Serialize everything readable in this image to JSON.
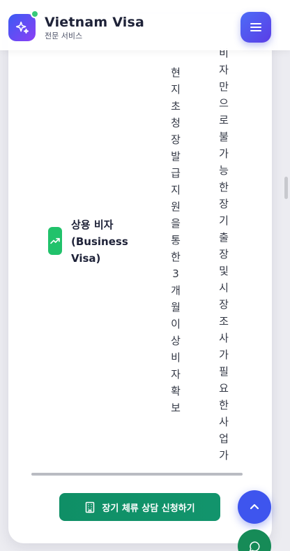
{
  "header": {
    "title": "Vietnam Visa",
    "subtitle": "전문 서비스",
    "logo_icon": "sparkles-icon",
    "menu_icon": "hamburger-menu-icon"
  },
  "row": {
    "icon": "trending-up-icon",
    "type_label": "상용 비자 (Business Visa)",
    "requirement": "현지초청장발급지원을통한3개월이상비자확보",
    "target": "비자만으로불가능한장기출장및시장조사가필요한사업가"
  },
  "cta": {
    "label": "장기 체류 상담 신청하기",
    "icon": "building-icon"
  },
  "floating": {
    "scroll_top_icon": "chevron-up-icon",
    "chat_icon": "chat-bubble-icon"
  },
  "colors": {
    "brand_gradient_start": "#3b5bf3",
    "brand_gradient_end": "#8b3ff5",
    "cta_green": "#0f8f66",
    "icon_green": "#21c26b",
    "scroll_blue": "#3e55ee"
  }
}
